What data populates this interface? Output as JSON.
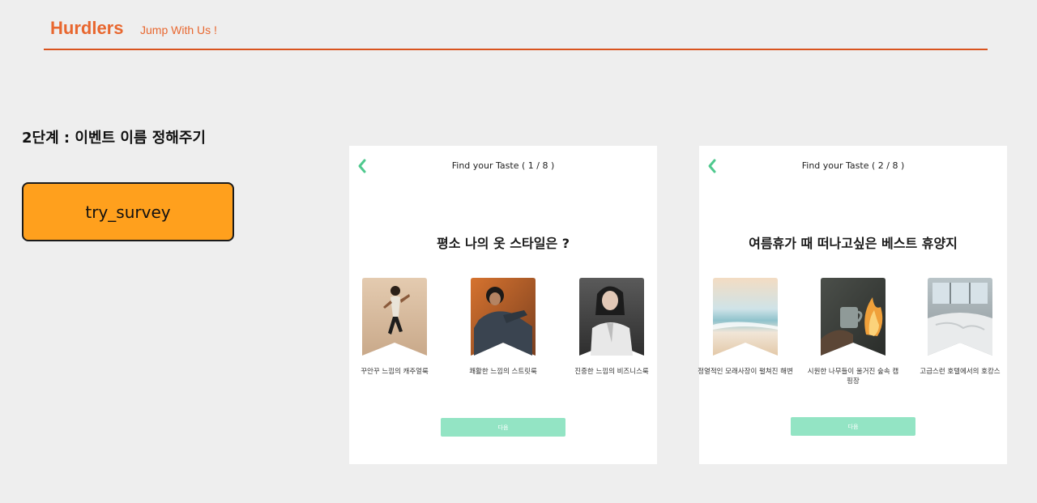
{
  "header": {
    "brand": "Hurdlers",
    "tagline": "Jump With Us !"
  },
  "step": {
    "title": "2단계 : 이벤트 이름 정해주기",
    "button_label": "try_survey"
  },
  "colors": {
    "brand": "#e8672f",
    "accent_button": "#ffa01d",
    "mint": "#93e4c4",
    "back_arrow": "#4fc98e"
  },
  "cards": [
    {
      "title": "Find your Taste ( 1 / 8 )",
      "question": "평소 나의 옷 스타일은 ?",
      "options": [
        {
          "label": "꾸안꾸 느낌의 캐주얼룩",
          "photo": "person-dancing-photo"
        },
        {
          "label": "쾌활한 느낌의 스트릿룩",
          "photo": "person-streetwear-photo"
        },
        {
          "label": "진중한 느낌의 비즈니스룩",
          "photo": "person-business-photo"
        }
      ],
      "next_label": "다음"
    },
    {
      "title": "Find your Taste ( 2 / 8 )",
      "question": "여름휴가 때 떠나고싶은 베스트 휴양지",
      "options": [
        {
          "label": "정열적인 모래사장이 펼쳐진 해변",
          "photo": "beach-photo"
        },
        {
          "label": "시원한 나무들이 울거진 숲속 캠핑장",
          "photo": "campfire-photo"
        },
        {
          "label": "고급스런 호텔에서의 호캉스",
          "photo": "hotel-bed-photo"
        }
      ],
      "next_label": "다음"
    }
  ]
}
